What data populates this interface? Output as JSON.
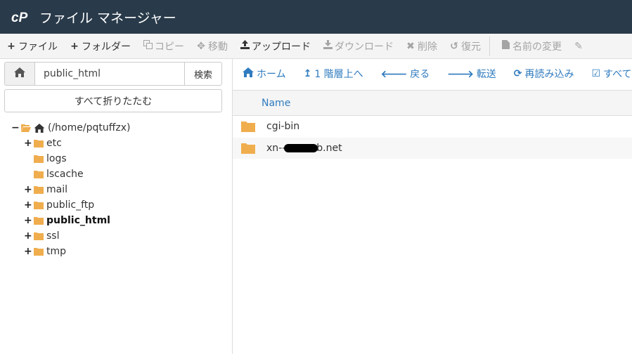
{
  "app": {
    "title": "ファイル マネージャー"
  },
  "toolbar": {
    "items": [
      {
        "label": "ファイル",
        "icon": "plus-icon",
        "enabled": true
      },
      {
        "label": "フォルダー",
        "icon": "plus-icon",
        "enabled": true
      },
      {
        "label": "コピー",
        "icon": "copy-icon",
        "enabled": false
      },
      {
        "label": "移動",
        "icon": "move-icon",
        "enabled": false
      },
      {
        "label": "アップロード",
        "icon": "upload-icon",
        "enabled": true
      },
      {
        "label": "ダウンロード",
        "icon": "download-icon",
        "enabled": false
      },
      {
        "label": "削除",
        "icon": "delete-icon",
        "enabled": false
      },
      {
        "label": "復元",
        "icon": "restore-icon",
        "enabled": false
      },
      {
        "label": "名前の変更",
        "icon": "file-icon",
        "enabled": false
      }
    ]
  },
  "sidebar": {
    "path_value": "public_html",
    "go_label": "検索",
    "collapse_label": "すべて折りたたむ",
    "tree": {
      "root": {
        "label": "(/home/pqtuffzx)",
        "expanded": true
      },
      "children": [
        {
          "label": "etc",
          "expandable": true,
          "bold": false
        },
        {
          "label": "logs",
          "expandable": false,
          "bold": false
        },
        {
          "label": "lscache",
          "expandable": false,
          "bold": false
        },
        {
          "label": "mail",
          "expandable": true,
          "bold": false
        },
        {
          "label": "public_ftp",
          "expandable": true,
          "bold": false
        },
        {
          "label": "public_html",
          "expandable": true,
          "bold": true
        },
        {
          "label": "ssl",
          "expandable": true,
          "bold": false
        },
        {
          "label": "tmp",
          "expandable": true,
          "bold": false
        }
      ]
    }
  },
  "nav": {
    "items": [
      {
        "label": "ホーム",
        "icon": "home-icon"
      },
      {
        "label": "1 階層上へ",
        "icon": "level-up-icon"
      },
      {
        "label": "戻る",
        "icon": "arrow-left-icon"
      },
      {
        "label": "転送",
        "icon": "arrow-right-icon"
      },
      {
        "label": "再読み込み",
        "icon": "refresh-icon"
      },
      {
        "label": "すべて選択",
        "icon": "check-square-icon"
      }
    ]
  },
  "file_list": {
    "column_name": "Name",
    "rows": [
      {
        "name": "cgi-bin",
        "type": "folder"
      },
      {
        "name_prefix": "xn--",
        "name_suffix": "b.net",
        "type": "folder",
        "redacted": true
      }
    ]
  },
  "colors": {
    "topbar": "#293a4a",
    "accent": "#2f7bbf",
    "folder": "#f0ad4e"
  }
}
